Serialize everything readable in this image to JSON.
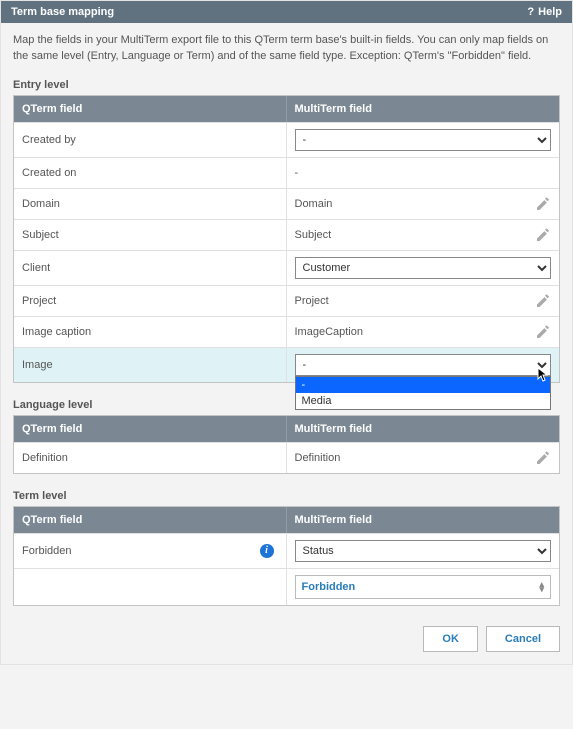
{
  "title": "Term base mapping",
  "help": "Help",
  "description": "Map the fields in your MultiTerm export file to this QTerm term base's built-in fields. You can only map fields on the same level (Entry, Language or Term) and of the same field type. Exception: QTerm's \"Forbidden\" field.",
  "columns": {
    "left": "QTerm field",
    "right": "MultiTerm field"
  },
  "sections": {
    "entry": {
      "label": "Entry level",
      "rows": [
        {
          "q": "Created by",
          "type": "select",
          "value": "-"
        },
        {
          "q": "Created on",
          "type": "text",
          "value": "-"
        },
        {
          "q": "Domain",
          "type": "text",
          "value": "Domain",
          "editable": true
        },
        {
          "q": "Subject",
          "type": "text",
          "value": "Subject",
          "editable": true
        },
        {
          "q": "Client",
          "type": "select",
          "value": "Customer"
        },
        {
          "q": "Project",
          "type": "text",
          "value": "Project",
          "editable": true
        },
        {
          "q": "Image caption",
          "type": "text",
          "value": "ImageCaption",
          "editable": true
        },
        {
          "q": "Image",
          "type": "select",
          "value": "-",
          "open": true,
          "highlight": true,
          "options": [
            "-",
            "Media"
          ],
          "selected_index": 0
        }
      ]
    },
    "language": {
      "label": "Language level",
      "rows": [
        {
          "q": "Definition",
          "type": "text",
          "value": "Definition",
          "editable": true
        }
      ]
    },
    "term": {
      "label": "Term level",
      "rows": [
        {
          "q": "Forbidden",
          "type": "select",
          "value": "Status",
          "info": true,
          "sub_value": "Forbidden"
        }
      ]
    }
  },
  "buttons": {
    "ok": "OK",
    "cancel": "Cancel"
  }
}
